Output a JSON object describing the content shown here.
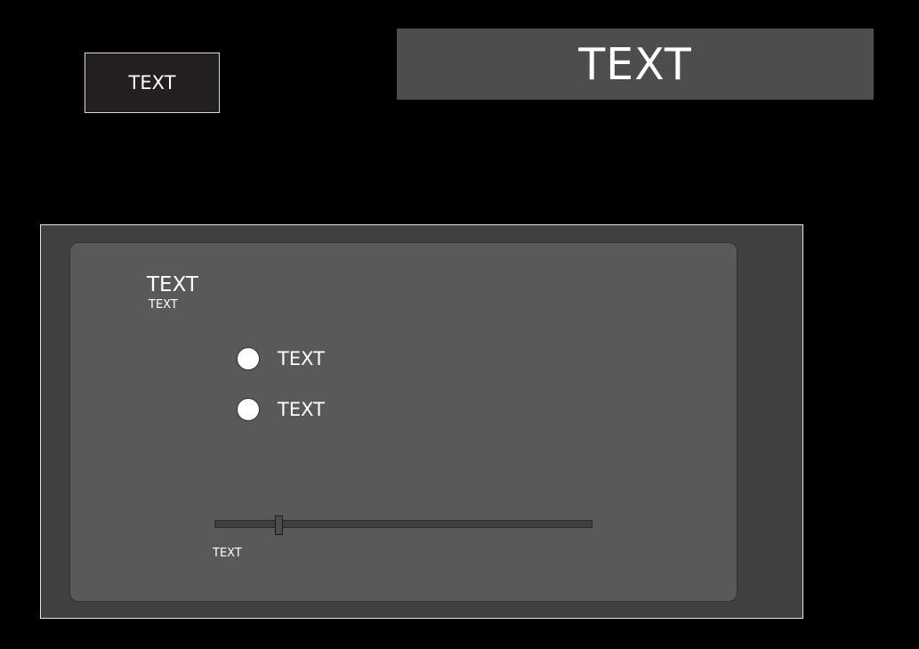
{
  "header": {
    "button_label": "TEXT",
    "title": "TEXT"
  },
  "panel": {
    "heading": "TEXT",
    "subheading": "TEXT",
    "radio_options": [
      {
        "label": "TEXT"
      },
      {
        "label": "TEXT"
      }
    ],
    "slider": {
      "caption": "TEXT",
      "value_fraction": 0.17
    }
  }
}
